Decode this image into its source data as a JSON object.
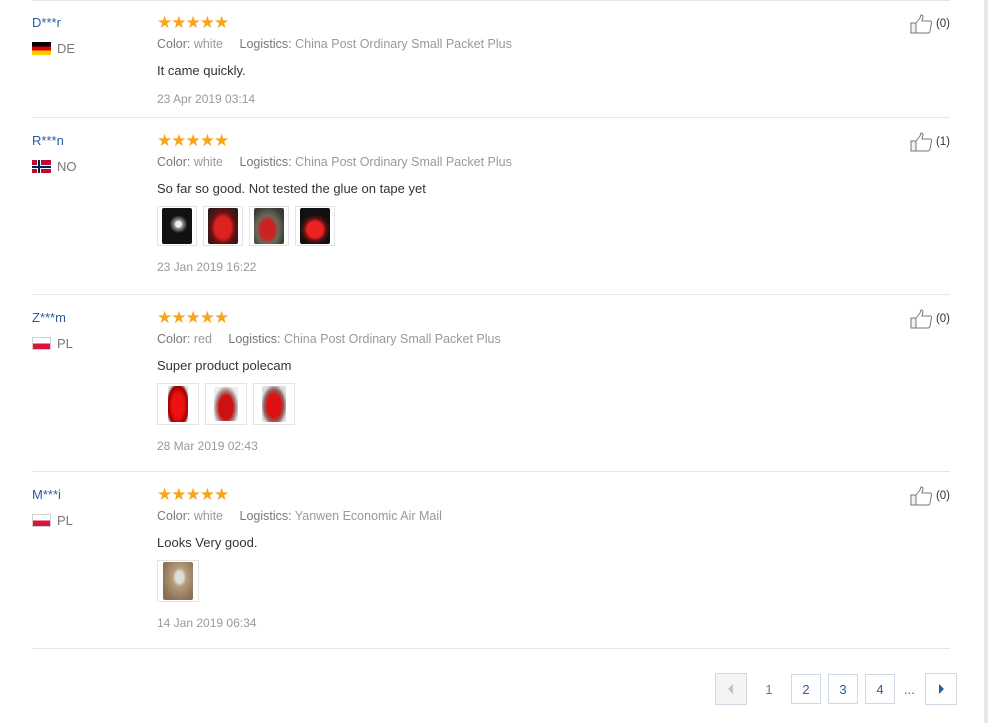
{
  "labels": {
    "color": "Color:",
    "logistics": "Logistics:"
  },
  "reviews": [
    {
      "user": "D***r",
      "country": "DE",
      "flag": "de",
      "stars": "★★★★★",
      "color": "white",
      "logistics": "China Post Ordinary Small Packet Plus",
      "text": "It came quickly.",
      "date": "23 Apr 2019 03:14",
      "likes": "(0)",
      "photos": []
    },
    {
      "user": "R***n",
      "country": "NO",
      "flag": "no",
      "stars": "★★★★★",
      "color": "white",
      "logistics": "China Post Ordinary Small Packet Plus",
      "text": "So far so good. Not tested the glue on tape yet",
      "date": "23 Jan 2019 16:22",
      "likes": "(1)",
      "photos": [
        "photo-1",
        "photo-2",
        "photo-3",
        "photo-4"
      ]
    },
    {
      "user": "Z***m",
      "country": "PL",
      "flag": "pl",
      "stars": "★★★★★",
      "color": "red",
      "logistics": "China Post Ordinary Small Packet Plus",
      "text": "Super product polecam",
      "date": "28 Mar 2019 02:43",
      "likes": "(0)",
      "photos": [
        "photo-1",
        "photo-2",
        "photo-3"
      ]
    },
    {
      "user": "M***i",
      "country": "PL",
      "flag": "pl",
      "stars": "★★★★★",
      "color": "white",
      "logistics": "Yanwen Economic Air Mail",
      "text": "Looks Very good.",
      "date": "14 Jan 2019 06:34",
      "likes": "(0)",
      "photos": [
        "photo-1"
      ]
    }
  ],
  "pagination": {
    "prev_icon": "chevron-left-icon",
    "current": "1",
    "pages": [
      "2",
      "3",
      "4"
    ],
    "ellipsis": "...",
    "next_icon": "chevron-right-icon"
  },
  "colors": {
    "link": "#2a5d9f",
    "star": "#f7a51c",
    "muted": "#999999",
    "border": "#e6e6e6"
  }
}
